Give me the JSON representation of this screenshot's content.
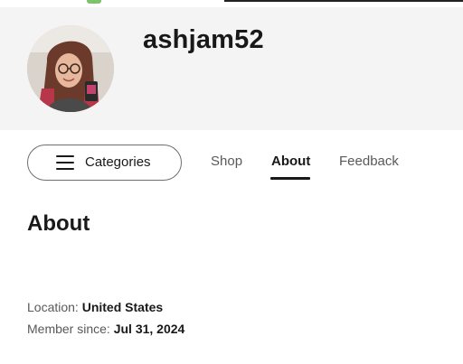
{
  "shop": {
    "username": "ashjam52"
  },
  "nav": {
    "categories_label": "Categories",
    "tabs": [
      {
        "label": "Shop",
        "active": false
      },
      {
        "label": "About",
        "active": true
      },
      {
        "label": "Feedback",
        "active": false
      }
    ]
  },
  "about": {
    "title": "About",
    "location_label": "Location:",
    "location_value": "United States",
    "member_since_label": "Member since:",
    "member_since_value": "Jul 31, 2024"
  },
  "colors": {
    "profile_band": "#f4f4f4",
    "text_primary": "#191919",
    "text_secondary": "#595959",
    "accent_green": "#7cc36a"
  }
}
